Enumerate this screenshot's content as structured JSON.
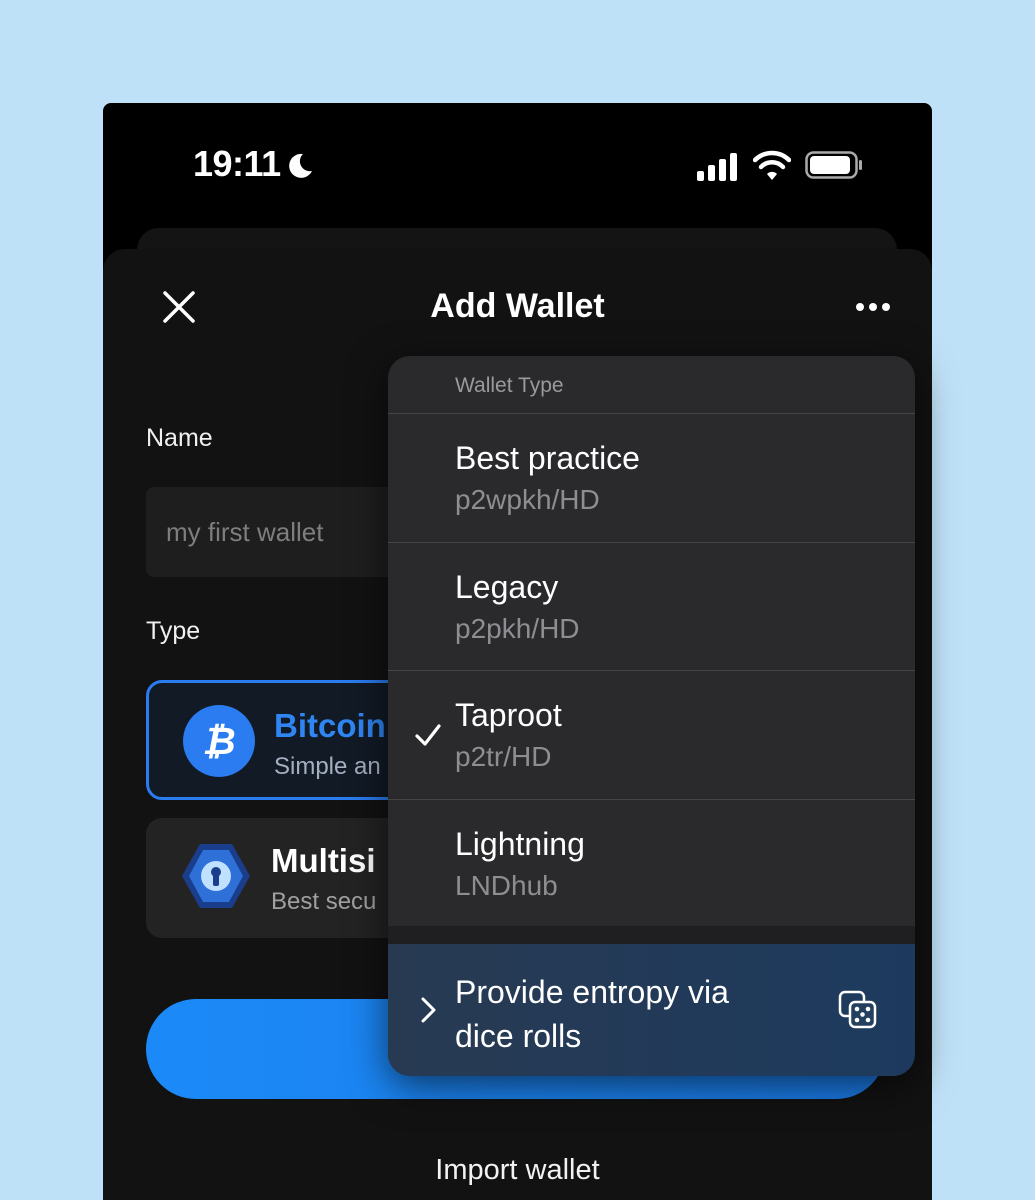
{
  "status_bar": {
    "time": "19:11",
    "icons": [
      "moon-icon",
      "signal-icon",
      "wifi-icon",
      "battery-icon"
    ]
  },
  "header": {
    "title": "Add Wallet",
    "close_icon": "close-icon",
    "more_icon": "more-icon"
  },
  "form": {
    "name_label": "Name",
    "name_placeholder": "my first wallet",
    "type_label": "Type",
    "types": [
      {
        "title": "Bitcoin",
        "subtitle": "Simple an",
        "icon": "bitcoin-icon",
        "selected": true
      },
      {
        "title": "Multisi",
        "subtitle": "Best secu",
        "icon": "vault-icon",
        "selected": false
      }
    ]
  },
  "import_label": "Import wallet",
  "menu": {
    "header": "Wallet Type",
    "items": [
      {
        "title": "Best practice",
        "subtitle": "p2wpkh/HD",
        "checked": false
      },
      {
        "title": "Legacy",
        "subtitle": "p2pkh/HD",
        "checked": false
      },
      {
        "title": "Taproot",
        "subtitle": "p2tr/HD",
        "checked": true
      },
      {
        "title": "Lightning",
        "subtitle": "LNDhub",
        "checked": false
      }
    ],
    "entropy": {
      "label": "Provide entropy via dice rolls",
      "icon": "dice-icon"
    }
  },
  "colors": {
    "accent": "#2a7cf0",
    "background": "#bfe1f7",
    "sheet": "#121212",
    "menu": "#2a2a2c"
  }
}
